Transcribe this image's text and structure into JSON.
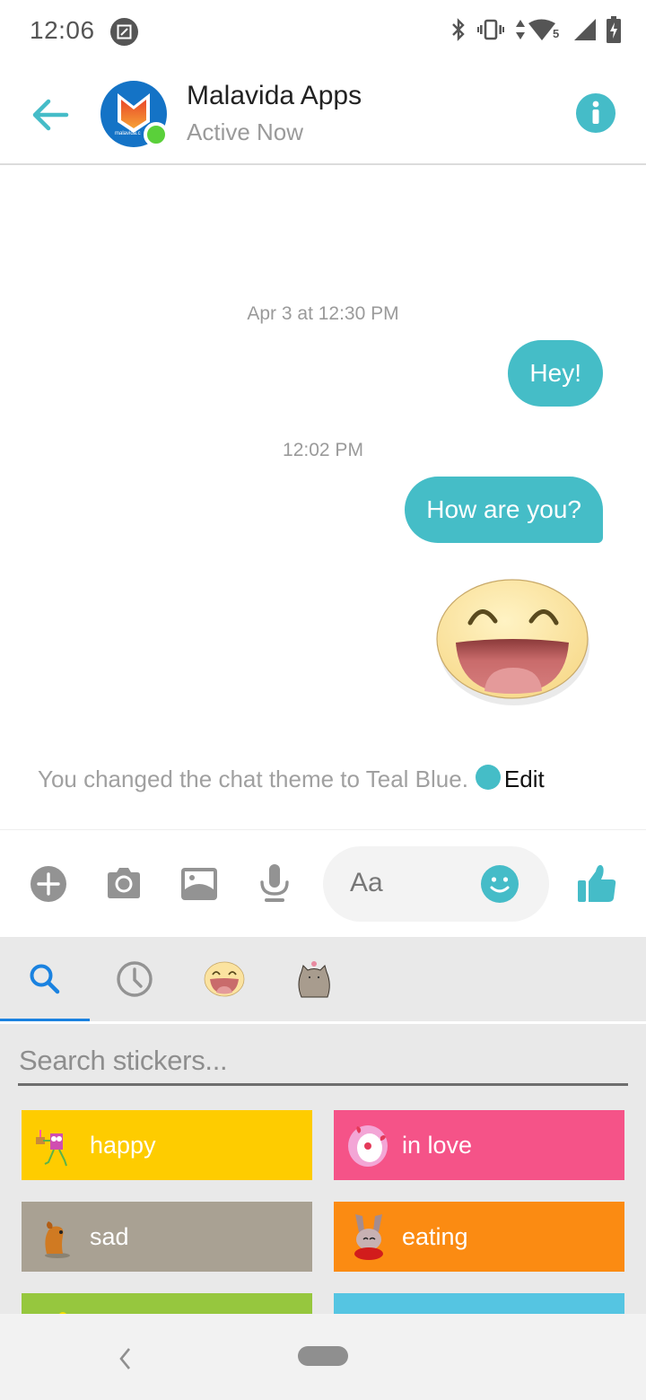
{
  "status_bar": {
    "time": "12:06",
    "icons": [
      "screenshot-edit-icon",
      "bluetooth-icon",
      "vibrate-icon",
      "data-arrows-icon",
      "wifi-icon",
      "cell-signal-icon",
      "battery-charging-icon"
    ],
    "wifi_label": "5"
  },
  "header": {
    "contact_name": "Malavida Apps",
    "contact_status": "Active Now",
    "avatar_caption": "malavida.c",
    "online": true,
    "accent_color": "#45bcc8"
  },
  "conversation": {
    "messages": [
      {
        "type": "timestamp",
        "text": "Apr 3 at 12:30 PM"
      },
      {
        "type": "outgoing",
        "text": "Hey!"
      },
      {
        "type": "timestamp",
        "text": "12:02 PM"
      },
      {
        "type": "outgoing",
        "text": "How are you?"
      },
      {
        "type": "sticker",
        "name": "laughing-face-sticker"
      }
    ],
    "theme_note": "You changed the chat theme to Teal Blue.",
    "theme_edit_label": "Edit",
    "theme_color": "#45bdc7"
  },
  "composer": {
    "placeholder": "Aa",
    "actions": [
      "add",
      "camera",
      "gallery",
      "microphone"
    ]
  },
  "stickers": {
    "tabs": [
      {
        "name": "search",
        "active": true
      },
      {
        "name": "recent",
        "active": false
      },
      {
        "name": "smiley-pack",
        "active": false
      },
      {
        "name": "pusheen-pack",
        "active": false
      }
    ],
    "search_placeholder": "Search stickers...",
    "categories": [
      {
        "label": "happy",
        "color": "#fecc00"
      },
      {
        "label": "in love",
        "color": "#f55388"
      },
      {
        "label": "sad",
        "color": "#a9a193"
      },
      {
        "label": "eating",
        "color": "#fb8b12"
      },
      {
        "label": "",
        "color": "#96c73e"
      },
      {
        "label": "",
        "color": "#55c5e2"
      }
    ]
  },
  "nav_bar": {
    "buttons": [
      "back",
      "home"
    ]
  }
}
